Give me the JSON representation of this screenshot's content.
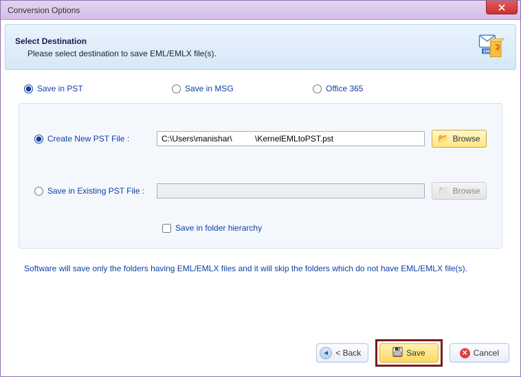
{
  "window": {
    "title": "Conversion Options"
  },
  "header": {
    "title": "Select Destination",
    "subtitle": "Please select destination to save EML/EMLX file(s)."
  },
  "dest_options": {
    "pst": "Save in PST",
    "msg": "Save in MSG",
    "o365": "Office 365"
  },
  "pst_options": {
    "create_new_label": "Create New PST File :",
    "create_new_path": "C:\\Users\\manishar\\          \\KernelEMLtoPST.pst",
    "save_existing_label": "Save in Existing PST File :",
    "save_existing_path": "",
    "browse_label": "Browse",
    "hierarchy_label": "Save in folder hierarchy"
  },
  "note": "Software will save only the folders having EML/EMLX files and it will skip the folders which do not have EML/EMLX file(s).",
  "buttons": {
    "back": "< Back",
    "save": "Save",
    "cancel": "Cancel"
  }
}
